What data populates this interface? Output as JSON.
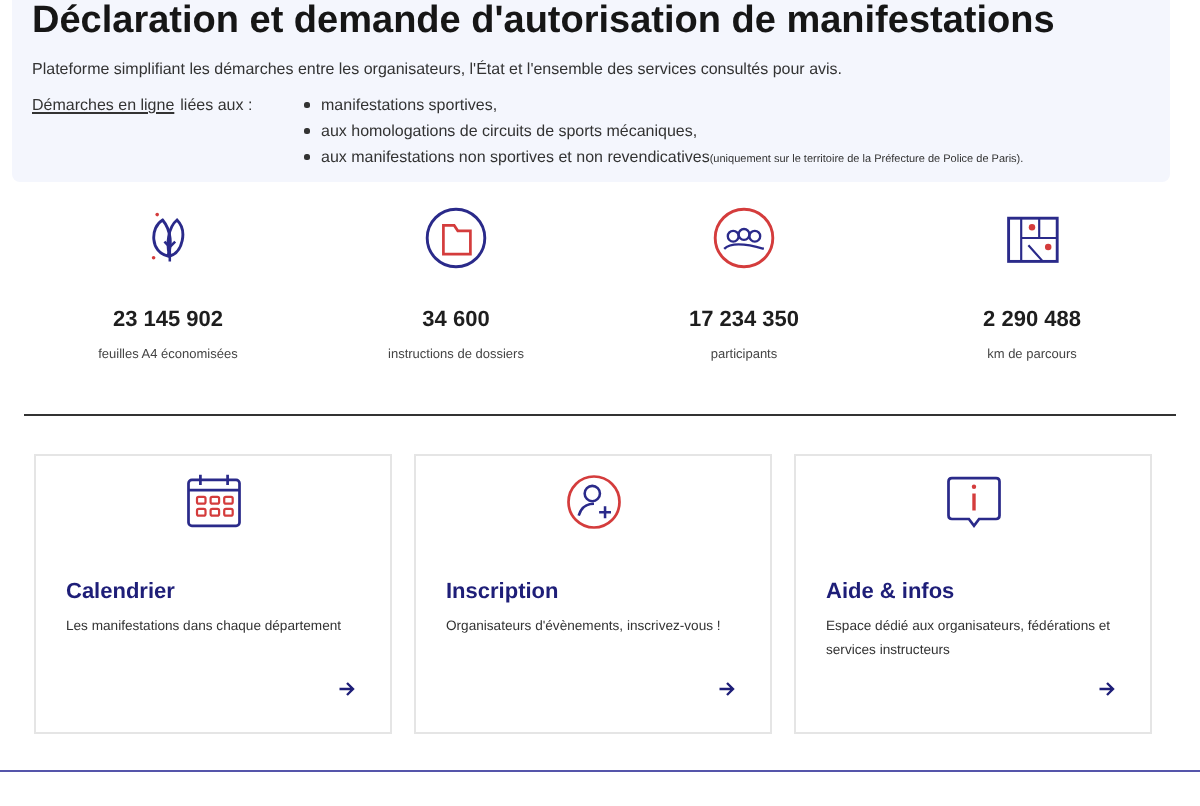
{
  "banner": {
    "title": "Déclaration et demande d'autorisation de manifestations",
    "intro": "Plateforme simplifiant les démarches entre les organisateurs, l'État et l'ensemble des services consultés pour avis.",
    "link": "Démarches en ligne",
    "link_suffix": "liées aux :",
    "items": [
      {
        "text": "manifestations sportives,"
      },
      {
        "text": "aux homologations de circuits de sports mécaniques,"
      },
      {
        "text": "aux manifestations non sportives et non revendicatives",
        "note": "(uniquement sur le territoire de la Préfecture de Police de Paris)."
      }
    ]
  },
  "stats": [
    {
      "value": "23 145 902",
      "label": "feuilles A4 économisées"
    },
    {
      "value": "34 600",
      "label": "instructions de dossiers"
    },
    {
      "value": "17 234 350",
      "label": "participants"
    },
    {
      "value": "2 290 488",
      "label": "km de parcours"
    }
  ],
  "cards": [
    {
      "title": "Calendrier",
      "text": "Les manifestations dans chaque département"
    },
    {
      "title": "Inscription",
      "text": "Organisateurs d'évènements, inscrivez-vous !"
    },
    {
      "title": "Aide & infos",
      "text": "Espace dédié aux organisateurs, fédérations et services instructeurs"
    }
  ]
}
